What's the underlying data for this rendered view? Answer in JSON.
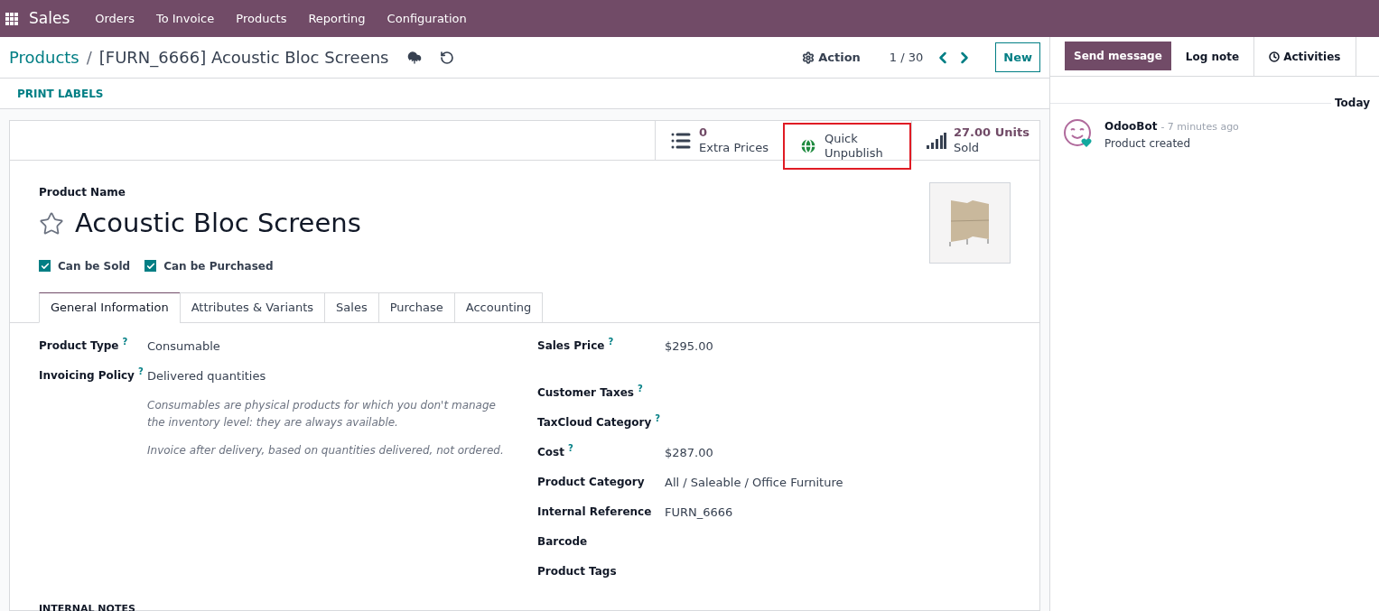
{
  "navbar": {
    "app": "Sales",
    "menu": [
      "Orders",
      "To Invoice",
      "Products",
      "Reporting",
      "Configuration"
    ]
  },
  "breadcrumb": {
    "parent": "Products",
    "separator": "/",
    "current": "[FURN_6666] Acoustic Bloc Screens"
  },
  "control_panel": {
    "action": "Action",
    "pager": "1 / 30",
    "new_button": "New"
  },
  "toolbar": {
    "print_labels": "PRINT LABELS"
  },
  "stat_buttons": [
    {
      "kind": "list",
      "value": "0",
      "label": "Extra Prices",
      "highlighted": false
    },
    {
      "kind": "globe",
      "value": "Quick",
      "label": "Unpublish",
      "highlighted": true
    },
    {
      "kind": "chart",
      "value": "27.00 Units",
      "label": "Sold",
      "highlighted": false
    }
  ],
  "product": {
    "name_label": "Product Name",
    "name": "Acoustic Bloc Screens",
    "favorite": false
  },
  "options": [
    {
      "label": "Can be Sold",
      "checked": true
    },
    {
      "label": "Can be Purchased",
      "checked": true
    }
  ],
  "tabs": [
    {
      "label": "General Information",
      "selected": true
    },
    {
      "label": "Attributes & Variants",
      "selected": false
    },
    {
      "label": "Sales",
      "selected": false
    },
    {
      "label": "Purchase",
      "selected": false
    },
    {
      "label": "Accounting",
      "selected": false
    }
  ],
  "left_fields": [
    {
      "label": "Product Type",
      "help": "?",
      "value": "Consumable"
    },
    {
      "label": "Invoicing Policy",
      "help": "?",
      "value": "Delivered quantities"
    }
  ],
  "hints": [
    "Consumables are physical products for which you don't manage the inventory level: they are always available.",
    "Invoice after delivery, based on quantities delivered, not ordered."
  ],
  "right_fields": [
    {
      "label": "Sales Price",
      "help": "?",
      "value": "$295.00"
    },
    {
      "label": "Customer Taxes",
      "help": "?"
    },
    {
      "label": "TaxCloud Category",
      "help": "?"
    },
    {
      "label": "Cost",
      "help": "?",
      "value": "$287.00"
    },
    {
      "label": "Product Category",
      "value": "All / Saleable / Office Furniture"
    },
    {
      "label": "Internal Reference",
      "value": "FURN_6666"
    },
    {
      "label": "Barcode"
    },
    {
      "label": "Product Tags"
    }
  ],
  "notes_heading": "INTERNAL NOTES",
  "chatter": {
    "tabs": [
      {
        "label": "Send message",
        "selected": true
      },
      {
        "label": "Log note",
        "selected": false
      },
      {
        "label": "Activities",
        "selected": false
      }
    ],
    "date_separator": "Today",
    "messages": [
      {
        "author": "OdooBot",
        "time": "- 7 minutes ago",
        "body": "Product created"
      }
    ]
  }
}
